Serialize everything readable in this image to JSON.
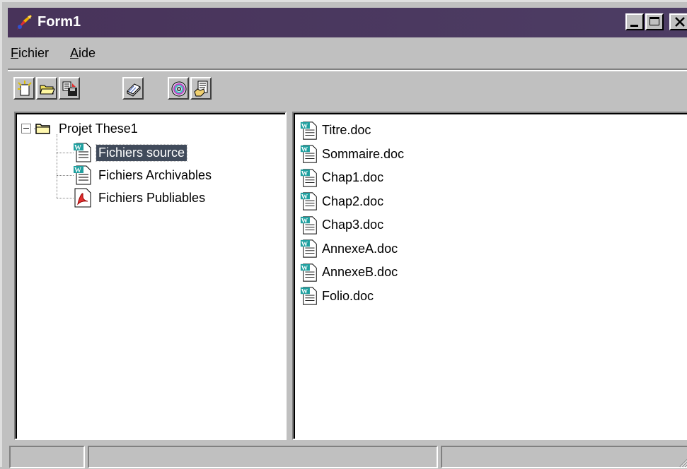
{
  "window": {
    "title": "Form1",
    "title_bar_color": "#48335a"
  },
  "menu": {
    "items": [
      {
        "label": "Fichier",
        "accel": "F",
        "rest": "ichier"
      },
      {
        "label": "Aide",
        "accel": "A",
        "rest": "ide"
      }
    ]
  },
  "toolbar": {
    "buttons": [
      {
        "name": "new-icon"
      },
      {
        "name": "open-folder-icon"
      },
      {
        "name": "save-icon"
      },
      {
        "name": "book-icon"
      },
      {
        "name": "cd-icon"
      },
      {
        "name": "document-hand-icon"
      }
    ]
  },
  "tree": {
    "root": {
      "label": "Projet These1",
      "expander": "⊟"
    },
    "children": [
      {
        "label": "Fichiers source",
        "icon": "word-doc-icon",
        "selected": true
      },
      {
        "label": "Fichiers Archivables",
        "icon": "word-doc-icon",
        "selected": false
      },
      {
        "label": "Fichiers Publiables",
        "icon": "pdf-doc-icon",
        "selected": false
      }
    ]
  },
  "files": [
    "Titre.doc",
    "Sommaire.doc",
    "Chap1.doc",
    "Chap2.doc",
    "Chap3.doc",
    "AnnexeA.doc",
    "AnnexeB.doc",
    "Folio.doc"
  ]
}
